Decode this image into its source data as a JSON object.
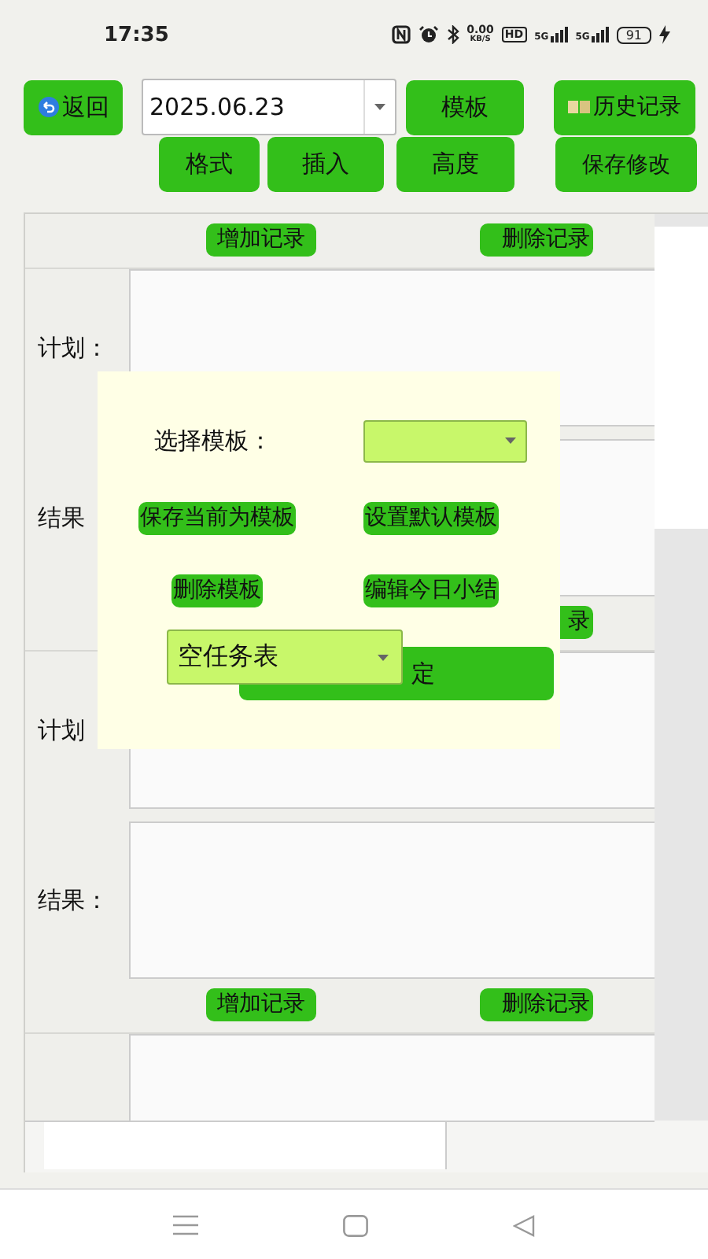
{
  "status_bar": {
    "time": "17:35",
    "net_speed": "0.00",
    "net_unit": "KB/S",
    "hd_badge": "HD",
    "signals": [
      {
        "label": "5G"
      },
      {
        "label": "5G"
      }
    ],
    "battery": "91"
  },
  "toolbar": {
    "back_button": "返回",
    "date_select": "2025.06.23",
    "template_button": "模板",
    "history_button": "历史记录",
    "row2": [
      "格式",
      "插入",
      "高度"
    ],
    "save_button": "保存修改"
  },
  "records": [
    {
      "kind": "actions",
      "buttons": [
        {
          "kind": "add",
          "label": "增加记录"
        },
        {
          "kind": "delete",
          "label": "删除记录"
        }
      ]
    },
    {
      "kind": "field",
      "label": "计划："
    },
    {
      "kind": "field",
      "label": "结果"
    },
    {
      "kind": "actions",
      "buttons": [
        {
          "kind": "delete",
          "label": "录"
        }
      ]
    },
    {
      "kind": "field",
      "label": "计划"
    },
    {
      "kind": "field",
      "label": "结果："
    },
    {
      "kind": "actions",
      "buttons": [
        {
          "kind": "add",
          "label": "增加记录"
        },
        {
          "kind": "delete",
          "label": "删除记录"
        }
      ]
    },
    {
      "kind": "field"
    }
  ],
  "dialog": {
    "select_label": "选择模板：",
    "buttons": [
      "保存当前为模板",
      "设置默认模板",
      "删除模板",
      "编辑今日小结"
    ],
    "confirm_button": "定",
    "task_select": "空任务表"
  }
}
